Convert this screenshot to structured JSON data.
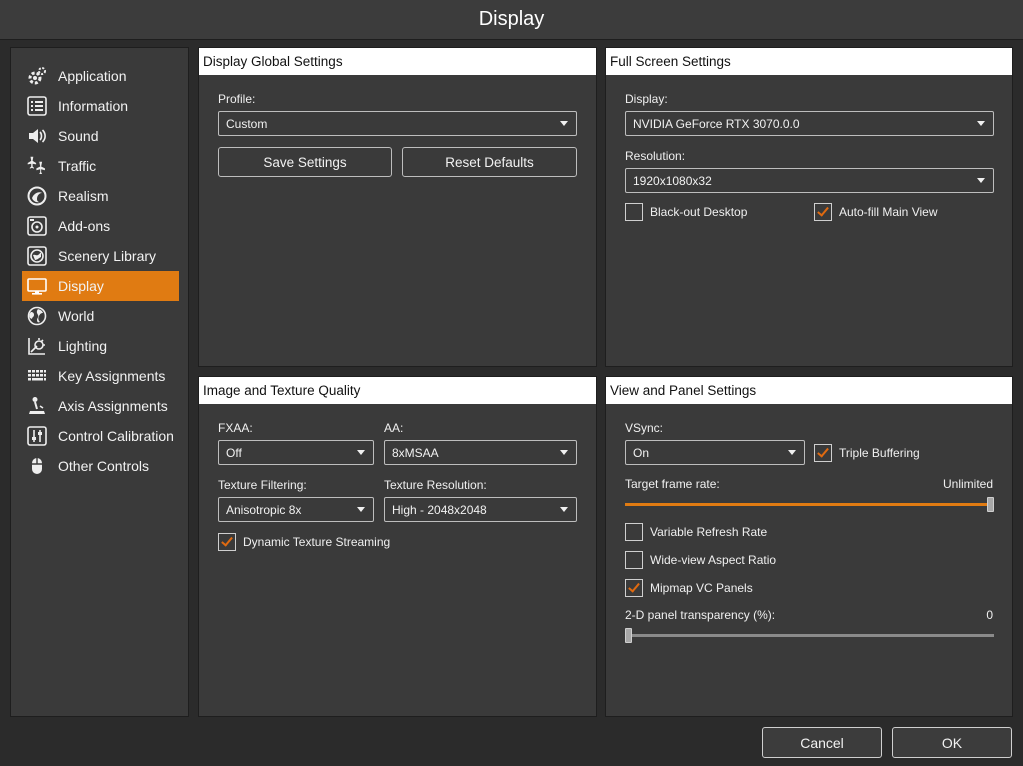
{
  "window": {
    "title": "Display"
  },
  "sidebar": {
    "items": [
      {
        "label": "Application",
        "icon": "gear-icon"
      },
      {
        "label": "Information",
        "icon": "list-icon"
      },
      {
        "label": "Sound",
        "icon": "speaker-icon"
      },
      {
        "label": "Traffic",
        "icon": "airplanes-icon"
      },
      {
        "label": "Realism",
        "icon": "realism-icon"
      },
      {
        "label": "Add-ons",
        "icon": "addons-icon"
      },
      {
        "label": "Scenery Library",
        "icon": "scenery-icon"
      },
      {
        "label": "Display",
        "icon": "monitor-icon",
        "active": true
      },
      {
        "label": "World",
        "icon": "globe-icon"
      },
      {
        "label": "Lighting",
        "icon": "lighting-icon"
      },
      {
        "label": "Key Assignments",
        "icon": "keyboard-icon"
      },
      {
        "label": "Axis Assignments",
        "icon": "joystick-icon"
      },
      {
        "label": "Control Calibration",
        "icon": "sliders-icon"
      },
      {
        "label": "Other Controls",
        "icon": "mouse-icon"
      }
    ],
    "accent_color": "#e07b12"
  },
  "global": {
    "header": "Display Global Settings",
    "profile_label": "Profile:",
    "profile_value": "Custom",
    "save_label": "Save Settings",
    "reset_label": "Reset Defaults"
  },
  "fullscreen": {
    "header": "Full Screen Settings",
    "display_label": "Display:",
    "display_value": "NVIDIA GeForce RTX 3070.0.0",
    "resolution_label": "Resolution:",
    "resolution_value": "1920x1080x32",
    "blackout_label": "Black-out Desktop",
    "blackout_checked": false,
    "autofill_label": "Auto-fill Main View",
    "autofill_checked": true
  },
  "image": {
    "header": "Image and Texture Quality",
    "fxaa_label": "FXAA:",
    "fxaa_value": "Off",
    "aa_label": "AA:",
    "aa_value": "8xMSAA",
    "filtering_label": "Texture Filtering:",
    "filtering_value": "Anisotropic 8x",
    "texres_label": "Texture Resolution:",
    "texres_value": "High - 2048x2048",
    "streaming_label": "Dynamic Texture Streaming",
    "streaming_checked": true
  },
  "view": {
    "header": "View and Panel Settings",
    "vsync_label": "VSync:",
    "vsync_value": "On",
    "triple_label": "Triple Buffering",
    "triple_checked": true,
    "framerate_label": "Target frame rate:",
    "framerate_value": "Unlimited",
    "framerate_fraction": 1.0,
    "vrr_label": "Variable Refresh Rate",
    "vrr_checked": false,
    "wide_label": "Wide-view Aspect Ratio",
    "wide_checked": false,
    "mipmap_label": "Mipmap VC Panels",
    "mipmap_checked": true,
    "transparency_label": "2-D panel transparency (%):",
    "transparency_value": "0",
    "transparency_fraction": 0.0
  },
  "footer": {
    "cancel_label": "Cancel",
    "ok_label": "OK"
  }
}
